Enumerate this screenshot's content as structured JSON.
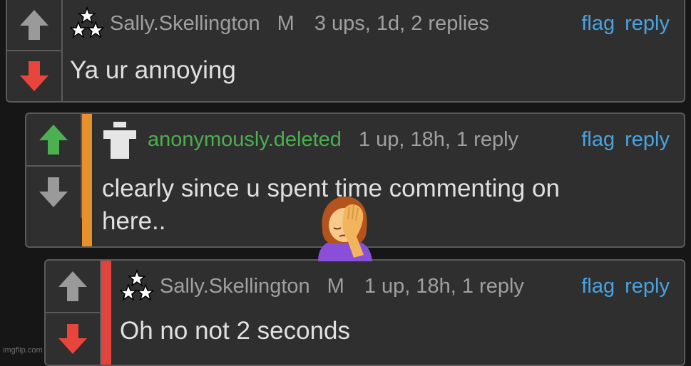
{
  "colors": {
    "background": "#161616",
    "panel": "#2f2f2f",
    "border": "#5a5a5a",
    "link": "#4aa3df",
    "meta_text": "#a0a0a0",
    "body_text": "#e0e0e0",
    "deleted_user": "#4caf50",
    "upvote_active": "#4caf50",
    "downvote_active": "#e8453c",
    "vote_inactive": "#9a9a9a",
    "reply_bar_1": "#e8902e",
    "reply_bar_2": "#e0443c"
  },
  "comments": [
    {
      "username": "Sally.Skellington",
      "mod_badge": "M",
      "meta": "3 ups, 1d, 2 replies",
      "flag_label": "flag",
      "reply_label": "reply",
      "body": "Ya ur annoying",
      "vote_state": "downvoted",
      "avatar_icon": "three-stars-icon"
    },
    {
      "username": "anonymously.deleted",
      "meta": "1 up, 18h, 1 reply",
      "flag_label": "flag",
      "reply_label": "reply",
      "body_lines": [
        "clearly since u spent time commenting on",
        "here.."
      ],
      "vote_state": "upvoted",
      "avatar_icon": "deleted-user-icon"
    },
    {
      "username": "Sally.Skellington",
      "mod_badge": "M",
      "meta": "1 up, 18h, 1 reply",
      "flag_label": "flag",
      "reply_label": "reply",
      "body": "Oh no not 2 seconds",
      "vote_state": "downvoted",
      "avatar_icon": "three-stars-icon"
    }
  ],
  "overlay_icon": "facepalm-emoji",
  "watermark": "imgflip.com"
}
